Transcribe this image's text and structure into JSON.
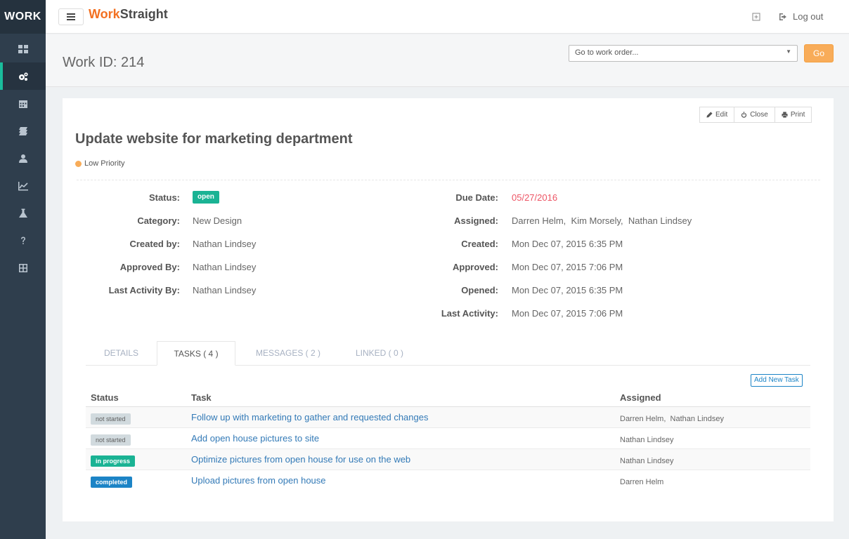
{
  "sidebar": {
    "brand": "WORK",
    "items": [
      {
        "icon": "dashboard-icon"
      },
      {
        "icon": "cogs-icon",
        "active": true
      },
      {
        "icon": "calendar-icon"
      },
      {
        "icon": "books-icon"
      },
      {
        "icon": "user-icon"
      },
      {
        "icon": "line-chart-icon"
      },
      {
        "icon": "flask-icon"
      },
      {
        "icon": "question-icon"
      },
      {
        "icon": "grid-icon"
      }
    ]
  },
  "topbar": {
    "logo_part1": "Work",
    "logo_part2": "Straight",
    "logout_label": "Log out"
  },
  "header": {
    "work_id": "Work ID: 214",
    "select_placeholder": "Go to work order...",
    "go_label": "Go"
  },
  "actions": {
    "edit": "Edit",
    "close": "Close",
    "print": "Print"
  },
  "work": {
    "title": "Update website for marketing department",
    "priority": "Low Priority",
    "labels": {
      "status": "Status:",
      "category": "Category:",
      "created_by": "Created by:",
      "approved_by": "Approved By:",
      "last_activity_by": "Last Activity By:",
      "due_date": "Due Date:",
      "assigned": "Assigned:",
      "created": "Created:",
      "approved": "Approved:",
      "opened": "Opened:",
      "last_activity": "Last Activity:"
    },
    "values": {
      "status": "open",
      "category": "New Design",
      "created_by": "Nathan Lindsey",
      "approved_by": "Nathan Lindsey",
      "last_activity_by": "Nathan Lindsey",
      "due_date": "05/27/2016",
      "assigned": "Darren Helm,  Kim Morsely,  Nathan Lindsey",
      "created": "Mon Dec 07, 2015 6:35 PM",
      "approved": "Mon Dec 07, 2015 7:06 PM",
      "opened": "Mon Dec 07, 2015 6:35 PM",
      "last_activity": "Mon Dec 07, 2015 7:06 PM"
    }
  },
  "tabs": [
    {
      "label": "DETAILS"
    },
    {
      "label": "TASKS ( 4 )",
      "active": true
    },
    {
      "label": "MESSAGES ( 2 )"
    },
    {
      "label": "LINKED ( 0 )"
    }
  ],
  "tasks": {
    "add_label": "Add New Task",
    "headers": {
      "status": "Status",
      "task": "Task",
      "assigned": "Assigned"
    },
    "rows": [
      {
        "status": "not started",
        "task": "Follow up with marketing to gather and requested changes",
        "assigned": "Darren Helm,  Nathan Lindsey"
      },
      {
        "status": "not started",
        "task": "Add open house pictures to site",
        "assigned": "Nathan Lindsey"
      },
      {
        "status": "in progress",
        "task": "Optimize pictures from open house for use on the web",
        "assigned": "Nathan Lindsey"
      },
      {
        "status": "completed",
        "task": "Upload pictures from open house",
        "assigned": "Darren Helm"
      }
    ]
  },
  "colors": {
    "accent_orange": "#f37021",
    "sidebar": "#2f3e4d",
    "status_open": "#1ab394",
    "status_completed": "#1c84c6",
    "due_date": "#ed5565"
  }
}
